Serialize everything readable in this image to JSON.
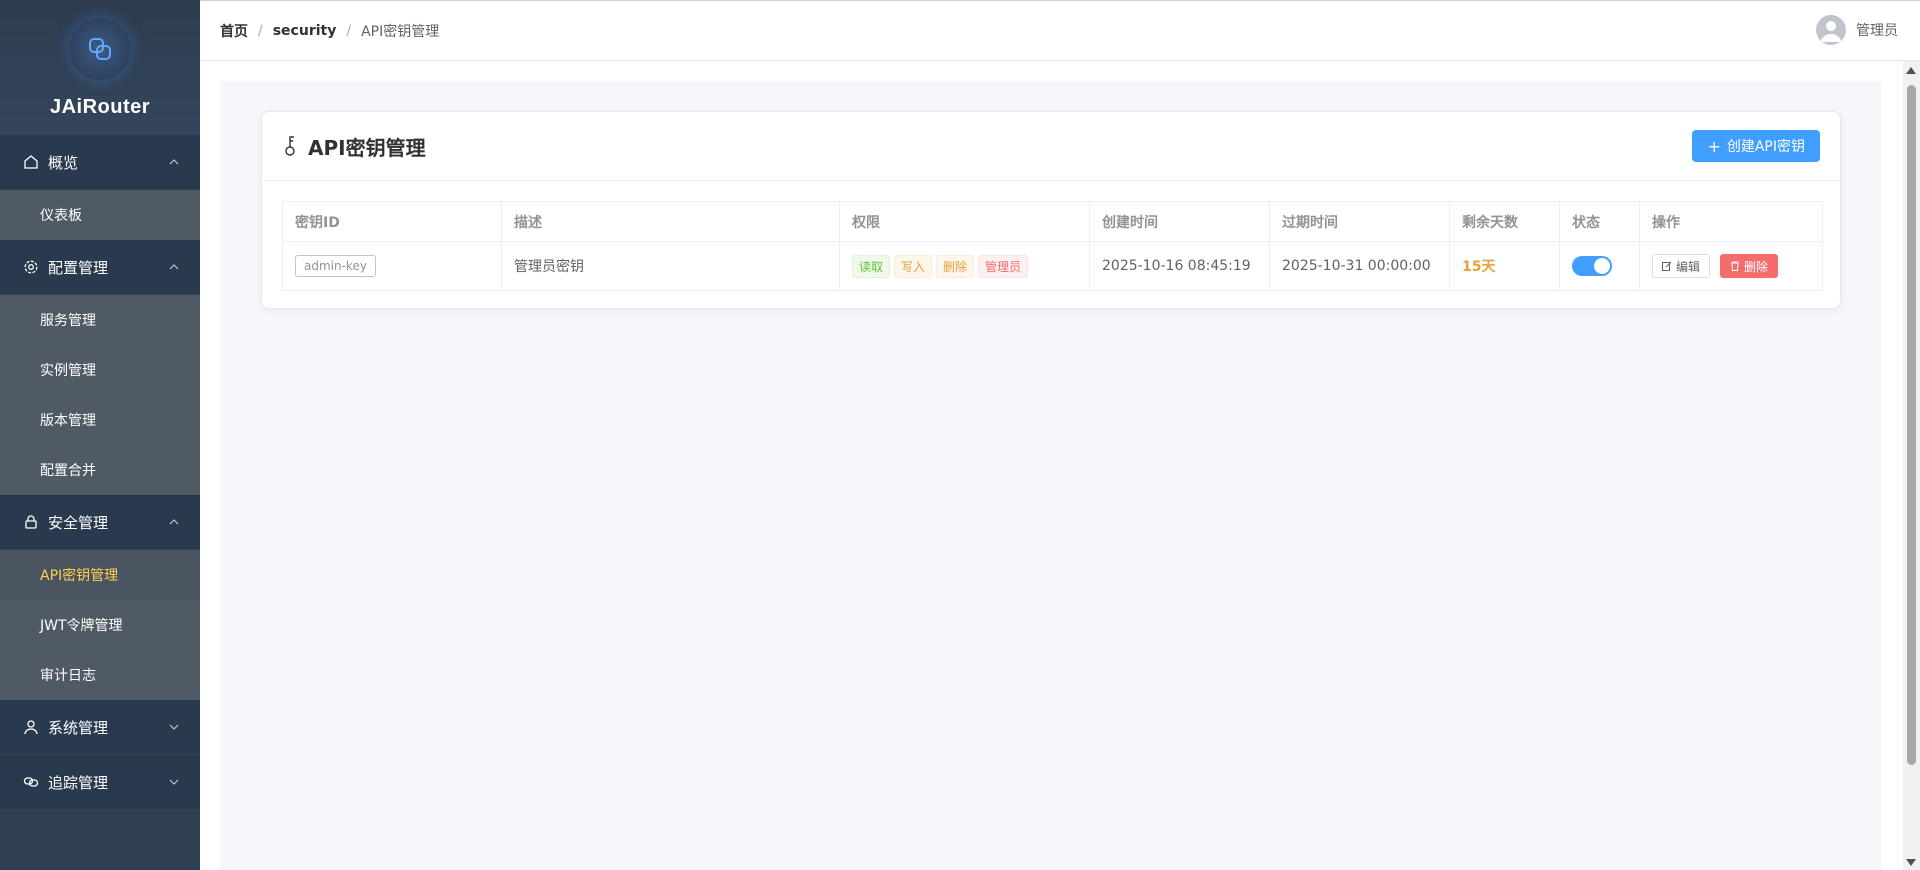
{
  "app": {
    "brand": "JAiRouter"
  },
  "breadcrumb": {
    "home": "首页",
    "section": "security",
    "current": "API密钥管理",
    "separator": "/"
  },
  "user": {
    "name": "管理员"
  },
  "sidebar": {
    "overview": {
      "label": "概览",
      "items": [
        "仪表板"
      ]
    },
    "config": {
      "label": "配置管理",
      "items": [
        "服务管理",
        "实例管理",
        "版本管理",
        "配置合并"
      ]
    },
    "security": {
      "label": "安全管理",
      "items": [
        "API密钥管理",
        "JWT令牌管理",
        "审计日志"
      ],
      "active": "API密钥管理"
    },
    "system": {
      "label": "系统管理"
    },
    "tracing": {
      "label": "追踪管理"
    }
  },
  "card": {
    "title": "API密钥管理",
    "create_button": "创建API密钥"
  },
  "table": {
    "headers": [
      "密钥ID",
      "描述",
      "权限",
      "创建时间",
      "过期时间",
      "剩余天数",
      "状态",
      "操作"
    ],
    "rows": [
      {
        "key_id": "admin-key",
        "description": "管理员密钥",
        "permissions": [
          "读取",
          "写入",
          "删除",
          "管理员"
        ],
        "created": "2025-10-16 08:45:19",
        "expires": "2025-10-31 00:00:00",
        "remaining": "15天",
        "enabled": true,
        "edit_label": "编辑",
        "delete_label": "删除"
      }
    ]
  },
  "colors": {
    "primary": "#409eff",
    "sidebar": "#2f3e50",
    "active": "#ffd04b",
    "danger": "#f56c6c",
    "warning": "#e6a23c",
    "success": "#67c23a"
  }
}
